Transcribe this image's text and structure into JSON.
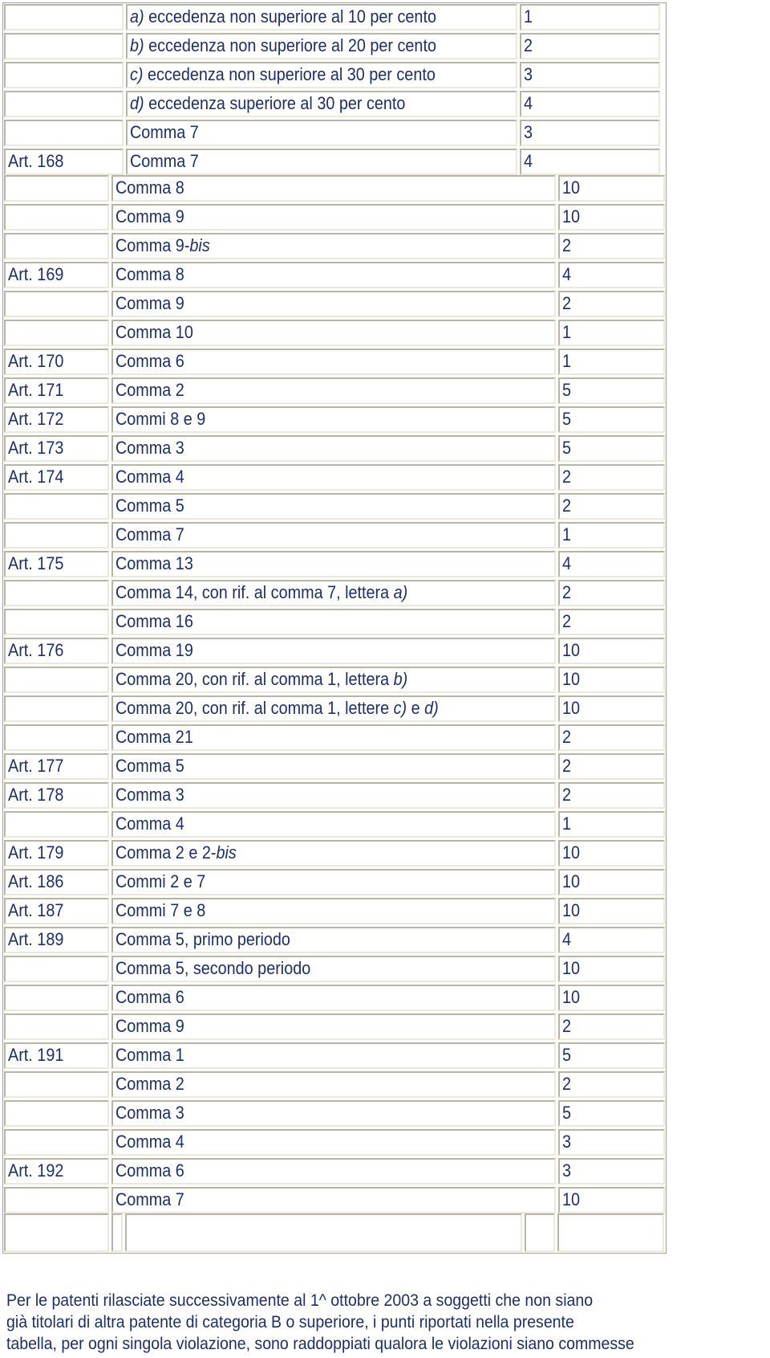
{
  "table": {
    "top_rows": [
      {
        "article": "",
        "comma_prefix_italic": "a)",
        "comma": " eccedenza non superiore al 10 per cento",
        "points": "1"
      },
      {
        "article": "",
        "comma_prefix_italic": "b)",
        "comma": " eccedenza non superiore al 20 per cento",
        "points": "2"
      },
      {
        "article": "",
        "comma_prefix_italic": "c)",
        "comma": " eccedenza non superiore al 30 per cento",
        "points": "3"
      },
      {
        "article": "",
        "comma_prefix_italic": "d)",
        "comma": " eccedenza superiore al 30 per cento",
        "points": "4"
      },
      {
        "article": "",
        "comma_prefix_italic": "",
        "comma": "Comma 7",
        "points": "3"
      },
      {
        "article": "Art. 168",
        "comma_prefix_italic": "",
        "comma": "Comma 7",
        "points": "4"
      }
    ],
    "rows": [
      {
        "article": "",
        "comma": "Comma 8",
        "comma_italic": "",
        "comma_suffix": "",
        "points": "10"
      },
      {
        "article": "",
        "comma": "Comma 9",
        "comma_italic": "",
        "comma_suffix": "",
        "points": "10"
      },
      {
        "article": "",
        "comma": "Comma 9-",
        "comma_italic": "bis",
        "comma_suffix": "",
        "points": "2"
      },
      {
        "article": "Art. 169",
        "comma": "Comma 8",
        "comma_italic": "",
        "comma_suffix": "",
        "points": "4"
      },
      {
        "article": "",
        "comma": "Comma 9",
        "comma_italic": "",
        "comma_suffix": "",
        "points": "2"
      },
      {
        "article": "",
        "comma": "Comma 10",
        "comma_italic": "",
        "comma_suffix": "",
        "points": "1"
      },
      {
        "article": "Art. 170",
        "comma": "Comma 6",
        "comma_italic": "",
        "comma_suffix": "",
        "points": "1"
      },
      {
        "article": "Art. 171",
        "comma": "Comma 2",
        "comma_italic": "",
        "comma_suffix": "",
        "points": "5"
      },
      {
        "article": "Art. 172",
        "comma": "Commi 8 e 9",
        "comma_italic": "",
        "comma_suffix": "",
        "points": "5"
      },
      {
        "article": "Art. 173",
        "comma": "Comma 3",
        "comma_italic": "",
        "comma_suffix": "",
        "points": "5"
      },
      {
        "article": "Art. 174",
        "comma": "Comma 4",
        "comma_italic": "",
        "comma_suffix": "",
        "points": "2"
      },
      {
        "article": "",
        "comma": "Comma 5",
        "comma_italic": "",
        "comma_suffix": "",
        "points": "2"
      },
      {
        "article": "",
        "comma": "Comma 7",
        "comma_italic": "",
        "comma_suffix": "",
        "points": "1"
      },
      {
        "article": "Art. 175",
        "comma": "Comma 13",
        "comma_italic": "",
        "comma_suffix": "",
        "points": "4"
      },
      {
        "article": "",
        "comma": "Comma 14, con rif. al comma 7, lettera ",
        "comma_italic": "a)",
        "comma_suffix": "",
        "points": "2"
      },
      {
        "article": "",
        "comma": "Comma 16",
        "comma_italic": "",
        "comma_suffix": "",
        "points": "2"
      },
      {
        "article": "Art. 176",
        "comma": "Comma 19",
        "comma_italic": "",
        "comma_suffix": "",
        "points": "10"
      },
      {
        "article": "",
        "comma": "Comma 20, con rif. al comma 1, lettera ",
        "comma_italic": "b)",
        "comma_suffix": "",
        "points": "10"
      },
      {
        "article": "",
        "comma": "Comma 20, con rif. al comma 1, lettere ",
        "comma_italic": "c)",
        "comma_suffix": " e ",
        "comma_italic2": "d)",
        "points": "10"
      },
      {
        "article": "",
        "comma": "Comma 21",
        "comma_italic": "",
        "comma_suffix": "",
        "points": "2"
      },
      {
        "article": "Art. 177",
        "comma": "Comma 5",
        "comma_italic": "",
        "comma_suffix": "",
        "points": "2"
      },
      {
        "article": "Art. 178",
        "comma": "Comma 3",
        "comma_italic": "",
        "comma_suffix": "",
        "points": "2"
      },
      {
        "article": "",
        "comma": "Comma 4",
        "comma_italic": "",
        "comma_suffix": "",
        "points": "1"
      },
      {
        "article": "Art. 179",
        "comma": "Comma 2 e 2-",
        "comma_italic": "bis",
        "comma_suffix": "",
        "points": "10"
      },
      {
        "article": "Art. 186",
        "comma": "Commi 2 e 7",
        "comma_italic": "",
        "comma_suffix": "",
        "points": "10"
      },
      {
        "article": "Art. 187",
        "comma": "Commi 7 e 8",
        "comma_italic": "",
        "comma_suffix": "",
        "points": "10"
      },
      {
        "article": "Art. 189",
        "comma": "Comma 5, primo periodo",
        "comma_italic": "",
        "comma_suffix": "",
        "points": "4"
      },
      {
        "article": "",
        "comma": "Comma 5, secondo periodo",
        "comma_italic": "",
        "comma_suffix": "",
        "points": "10"
      },
      {
        "article": "",
        "comma": "Comma 6",
        "comma_italic": "",
        "comma_suffix": "",
        "points": "10"
      },
      {
        "article": "",
        "comma": "Comma 9",
        "comma_italic": "",
        "comma_suffix": "",
        "points": "2"
      },
      {
        "article": "Art. 191",
        "comma": "Comma 1",
        "comma_italic": "",
        "comma_suffix": "",
        "points": "5"
      },
      {
        "article": "",
        "comma": "Comma 2",
        "comma_italic": "",
        "comma_suffix": "",
        "points": "2"
      },
      {
        "article": "",
        "comma": "Comma 3",
        "comma_italic": "",
        "comma_suffix": "",
        "points": "5"
      },
      {
        "article": "",
        "comma": "Comma 4",
        "comma_italic": "",
        "comma_suffix": "",
        "points": "3"
      },
      {
        "article": "Art. 192",
        "comma": "Comma 6",
        "comma_italic": "",
        "comma_suffix": "",
        "points": "3"
      },
      {
        "article": "",
        "comma": "Comma 7",
        "comma_italic": "",
        "comma_suffix": "",
        "points": "10"
      }
    ]
  },
  "note": {
    "lines": [
      "Per le patenti rilasciate successivamente al 1^ ottobre 2003 a soggetti che non siano",
      "già titolari di altra patente di categoria B o superiore, i punti riportati nella presente",
      "tabella, per ogni singola violazione, sono raddoppiati qualora le violazioni siano commesse"
    ]
  }
}
